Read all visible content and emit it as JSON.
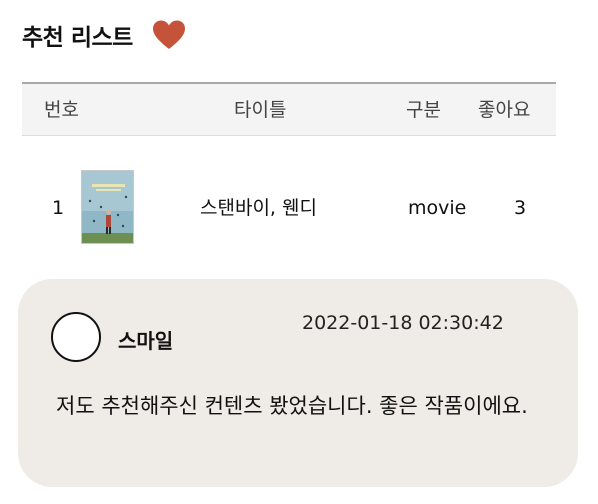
{
  "header": {
    "title": "추천 리스트",
    "icon": "heart-icon",
    "heart_color": "#c5533a"
  },
  "table": {
    "columns": [
      "번호",
      "타이틀",
      "구분",
      "좋아요"
    ],
    "rows": [
      {
        "no": "1",
        "thumbnail_icon": "poster-thumbnail",
        "title": "스탠바이, 웬디",
        "type": "movie",
        "likes": "3"
      }
    ]
  },
  "comment": {
    "avatar_icon": "avatar-circle-icon",
    "username": "스마일",
    "timestamp": "2022-01-18 02:30:42",
    "text": "저도 추천해주신 컨텐츠 봤었습니다. 좋은 작품이에요.",
    "background": "#efebe6"
  }
}
